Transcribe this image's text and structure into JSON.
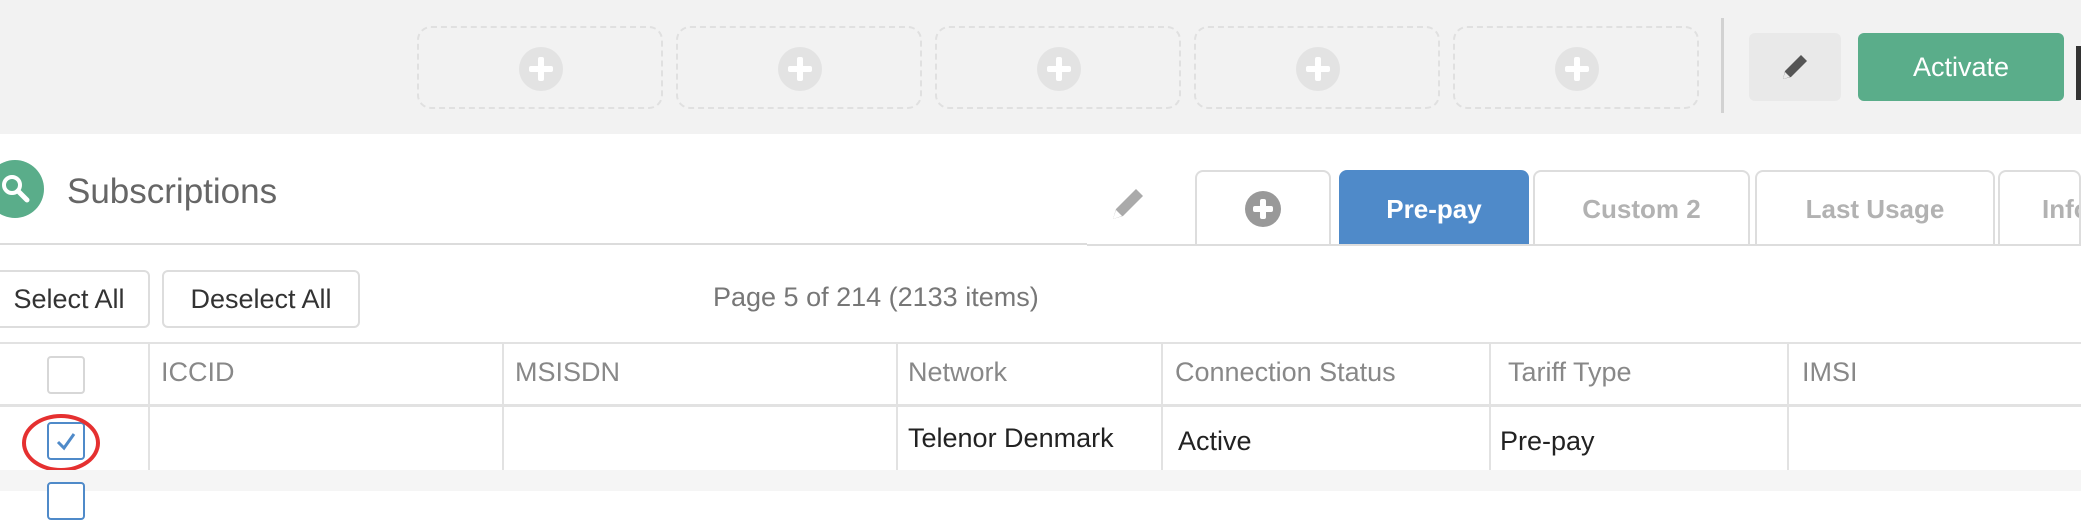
{
  "toolbar": {
    "slots": [
      "add-slot-1",
      "add-slot-2",
      "add-slot-3",
      "add-slot-4",
      "add-slot-5"
    ],
    "edit_icon": "pencil-icon",
    "activate_label": "Activate",
    "colors": {
      "activate": "#5aad8a",
      "toolbar_bg": "#f2f2f2"
    }
  },
  "section": {
    "icon": "search-icon",
    "title": "Subscriptions"
  },
  "tabs": {
    "edit_icon": "pencil-icon",
    "add_icon": "plus-circle-icon",
    "items": [
      {
        "label": "Pre-pay",
        "active": true
      },
      {
        "label": "Custom 2",
        "active": false
      },
      {
        "label": "Last Usage",
        "active": false
      },
      {
        "label": "Info",
        "active": false
      }
    ],
    "active_color": "#4f8ac9"
  },
  "actions": {
    "select_all": "Select All",
    "deselect_all": "Deselect All"
  },
  "pagination": {
    "text": "Page 5 of 214 (2133 items)"
  },
  "table": {
    "columns": [
      "ICCID",
      "MSISDN",
      "Network",
      "Connection Status",
      "Tariff Type",
      "IMSI"
    ],
    "rows": [
      {
        "checked": true,
        "iccid": "",
        "msisdn": "",
        "network": "Telenor Denmark",
        "connection_status": "Active",
        "tariff_type": "Pre-pay",
        "imsi": ""
      }
    ],
    "highlight_color": "#e53030"
  }
}
